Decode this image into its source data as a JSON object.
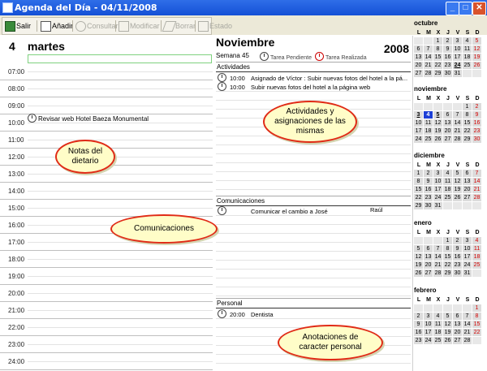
{
  "window": {
    "title": "Agenda del Día - 04/11/2008"
  },
  "toolbar": {
    "salir": "Salir",
    "anadir": "Añadir",
    "consultar": "Consultar",
    "modificar": "Modificar",
    "borrar": "Borrar",
    "estado": "Estado"
  },
  "day": {
    "number": "4",
    "name": "martes",
    "hours": [
      "07:00",
      "08:00",
      "09:00",
      "10:00",
      "11:00",
      "12:00",
      "13:00",
      "14:00",
      "15:00",
      "16:00",
      "17:00",
      "18:00",
      "19:00",
      "20:00",
      "21:00",
      "22:00",
      "23:00",
      "24:00"
    ],
    "note": "Revisar web Hotel Baeza Monumental"
  },
  "main": {
    "month": "Noviembre",
    "year": "2008",
    "week": "Semana 45",
    "legend_pending": "Tarea Pendiente",
    "legend_done": "Tarea Realizada",
    "sections": {
      "actividades": "Actividades",
      "comunicaciones": "Comunicaciones",
      "personal": "Personal"
    },
    "activities": [
      {
        "time": "10:00",
        "text": "Asignado de Víctor : Subir nuevas fotos del hotel a la pá..."
      },
      {
        "time": "10:00",
        "text": "Subir nuevas fotos del hotel a la página web"
      }
    ],
    "communication": {
      "text": "Comunicar el cambio a José",
      "who": "Raúl"
    },
    "personal": {
      "time": "20:00",
      "text": "Dentista"
    }
  },
  "callouts": {
    "notas": "Notas del dietario",
    "actividades": "Actividades y asignaciones de las mismas",
    "comunicaciones": "Comunicaciones",
    "personal": "Anotaciones de caracter personal"
  },
  "weekdays": [
    "L",
    "M",
    "X",
    "J",
    "V",
    "S",
    "D"
  ],
  "calendars": [
    {
      "name": "octubre",
      "offset": 2,
      "days": 31,
      "bold": [
        24
      ],
      "today": null
    },
    {
      "name": "noviembre",
      "offset": 5,
      "days": 30,
      "bold": [
        3,
        5
      ],
      "today": 4
    },
    {
      "name": "diciembre",
      "offset": 0,
      "days": 31,
      "bold": [],
      "today": null
    },
    {
      "name": "enero",
      "offset": 3,
      "days": 31,
      "bold": [],
      "today": null
    },
    {
      "name": "febrero",
      "offset": 6,
      "days": 28,
      "bold": [],
      "today": null
    }
  ],
  "colors": {
    "accent": "#1d3fd6",
    "callout_border": "#e02b17",
    "callout_fill": "#fffdc8",
    "sunday": "#d40000"
  }
}
